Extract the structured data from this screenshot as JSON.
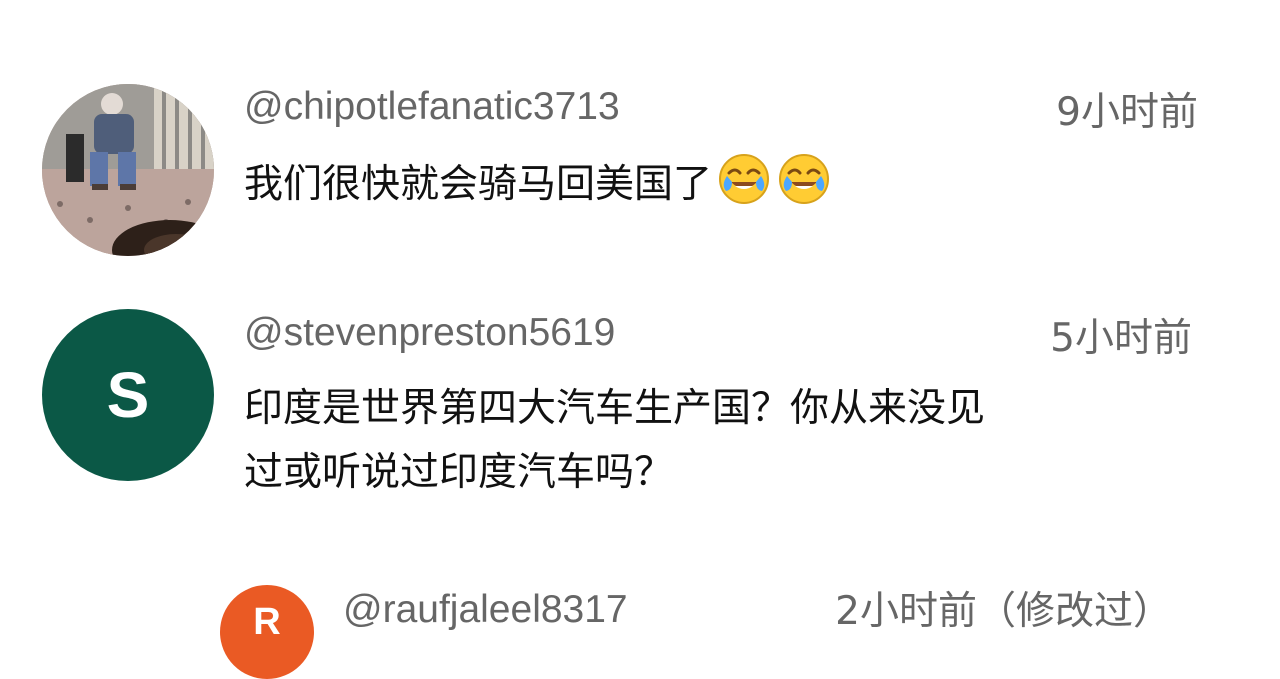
{
  "comments": [
    {
      "handle": "@chipotlefanatic3713",
      "time": "9小时前",
      "text": "我们很快就会骑马回美国了",
      "emojis": [
        "laughing-tears-emoji",
        "laughing-tears-emoji"
      ]
    },
    {
      "handle": "@stevenpreston5619",
      "time": "5小时前",
      "avatar_letter": "S",
      "avatar_color": "#0b5846",
      "text_line1": "印度是世界第四大汽车生产国？你从来没见",
      "text_line2": "过或听说过印度汽车吗？"
    },
    {
      "handle": "@raufjaleel8317",
      "time": "2小时前（修改过）",
      "avatar_letter": "R",
      "avatar_color": "#ea5a24"
    }
  ]
}
